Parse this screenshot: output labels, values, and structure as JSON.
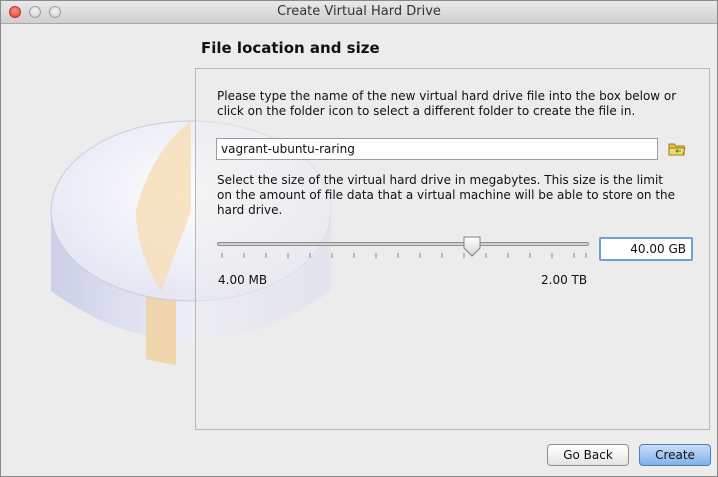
{
  "window": {
    "title": "Create Virtual Hard Drive"
  },
  "page": {
    "section_title": "File location and size",
    "instructions_location": "Please type the name of the new virtual hard drive file into the box below or click on the folder icon to select a different folder to create the file in.",
    "instructions_size": "Select the size of the virtual hard drive in megabytes. This size is the limit on the amount of file data that a virtual machine will be able to store on the hard drive."
  },
  "file": {
    "name": "vagrant-ubuntu-raring",
    "folder_icon": "folder-icon"
  },
  "size": {
    "min_label": "4.00 MB",
    "max_label": "2.00 TB",
    "value": "40.00 GB",
    "slider_position": 0.68
  },
  "buttons": {
    "back": "Go Back",
    "create": "Create"
  },
  "colors": {
    "accent": "#80b1ea",
    "focus_ring": "#6f9fd6",
    "close_button": "#e0443a"
  }
}
